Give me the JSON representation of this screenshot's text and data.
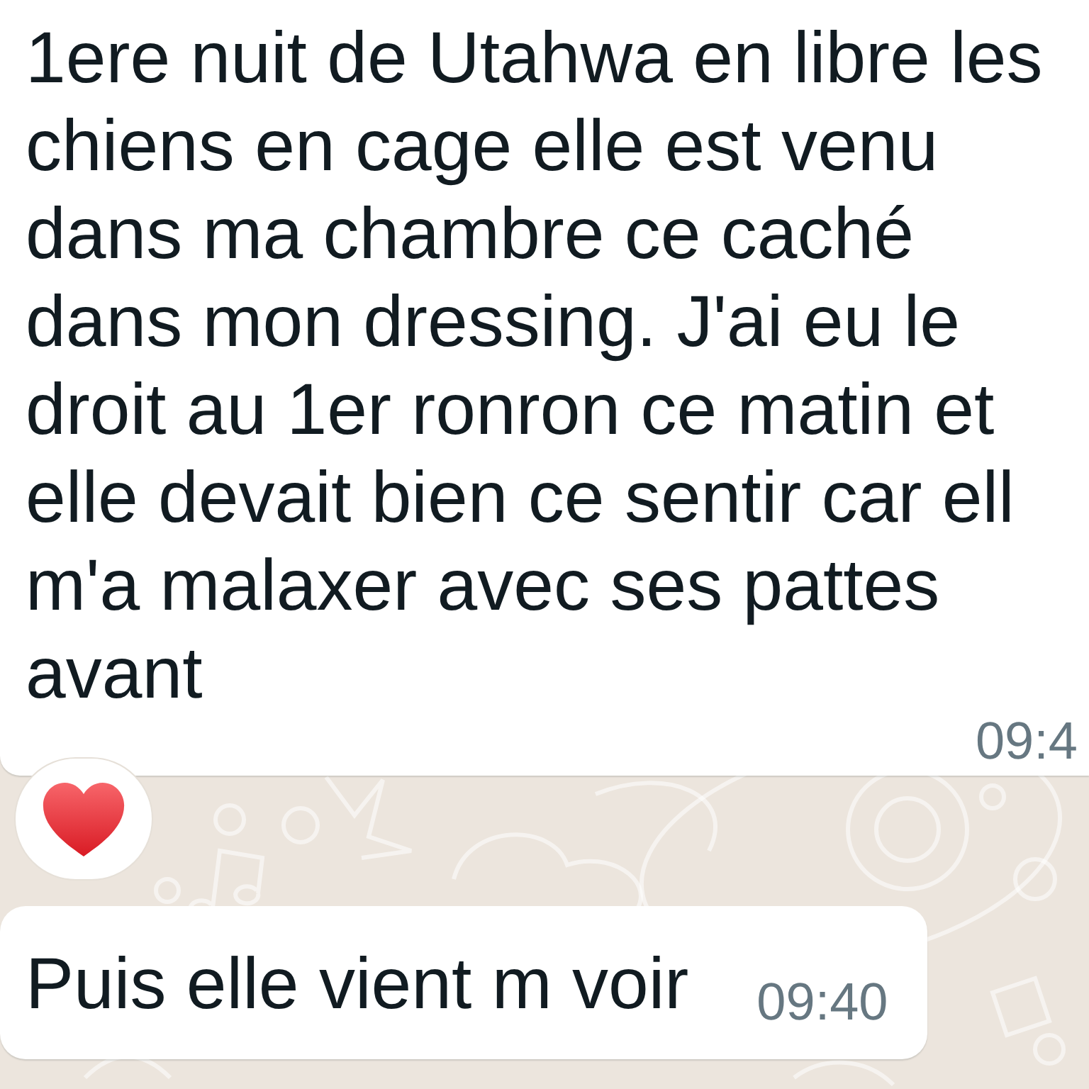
{
  "messages": [
    {
      "kind": "incoming",
      "text": "1ere nuit de Utahwa en libre les\nchiens en cage elle est venu\ndans ma chambre ce caché\ndans mon dressing. J'ai eu le\ndroit au 1er ronron ce matin et\nelle devait bien ce sentir car ell\nm'a malaxer avec ses pattes\navant",
      "time": "09:4",
      "has_reaction": true
    },
    {
      "kind": "incoming",
      "text": "Puis elle vient m voir",
      "time": "09:40",
      "has_reaction": false
    }
  ]
}
